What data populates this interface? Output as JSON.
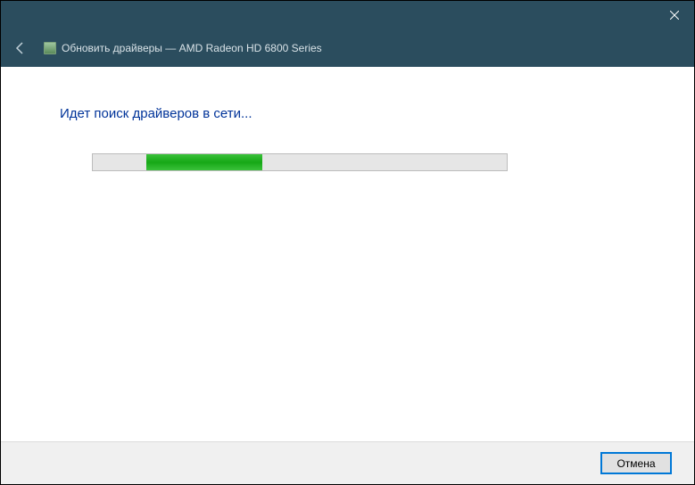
{
  "titlebar": {
    "close_label": "Close"
  },
  "header": {
    "title": "Обновить драйверы — AMD Radeon HD 6800 Series"
  },
  "content": {
    "status": "Идет поиск драйверов в сети..."
  },
  "footer": {
    "cancel_label": "Отмена"
  }
}
